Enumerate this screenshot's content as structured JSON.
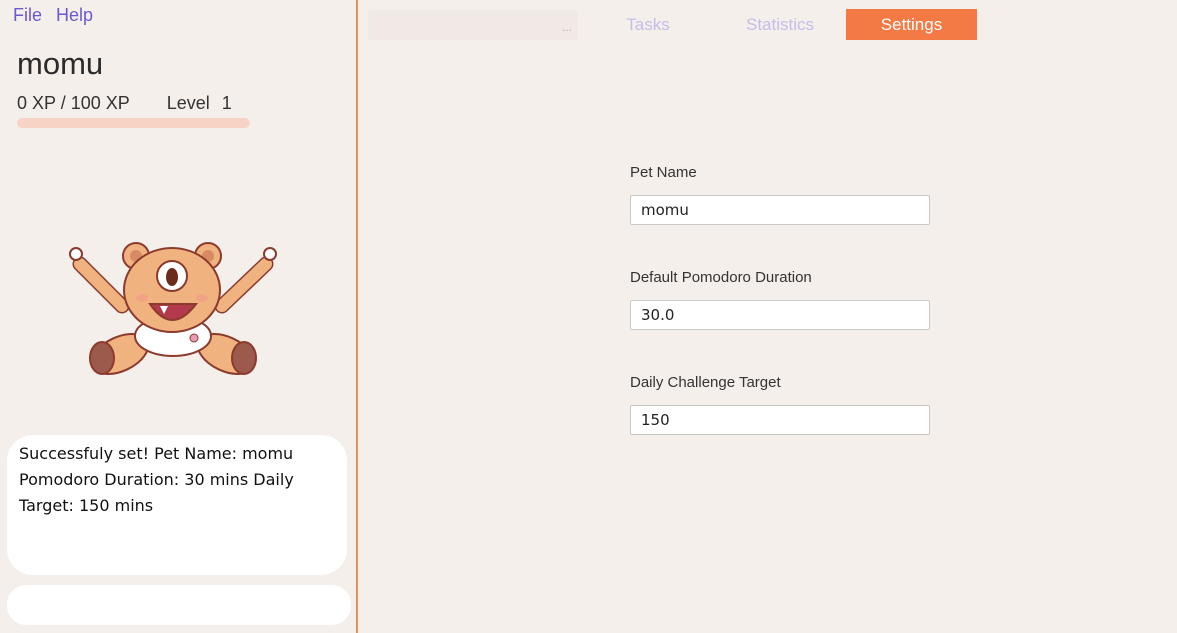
{
  "menu": {
    "file": "File",
    "help": "Help"
  },
  "pet": {
    "name": "momu",
    "xp_text": "0 XP / 100 XP",
    "level_label": "Level",
    "level_value": "1",
    "xp_progress": 0
  },
  "message": "Successfuly set! Pet Name: momu Pomodoro Duration: 30 mins Daily Target: 150 mins",
  "command_input": {
    "value": ""
  },
  "search": {
    "placeholder": "..."
  },
  "tabs": [
    {
      "label": "Tasks"
    },
    {
      "label": "Statistics"
    },
    {
      "label": "Settings"
    }
  ],
  "settings": {
    "pet_name_label": "Pet Name",
    "pet_name_value": "momu",
    "duration_label": "Default Pomodoro Duration",
    "duration_value": "30.0",
    "target_label": "Daily Challenge Target",
    "target_value": "150"
  },
  "colors": {
    "accent": "#f47a45",
    "divider": "#e0915f",
    "menu": "#6a5acd",
    "xp_bar_bg": "#f7d3c5",
    "inactive_tab": "#c6bde8",
    "background": "#f5efec"
  }
}
